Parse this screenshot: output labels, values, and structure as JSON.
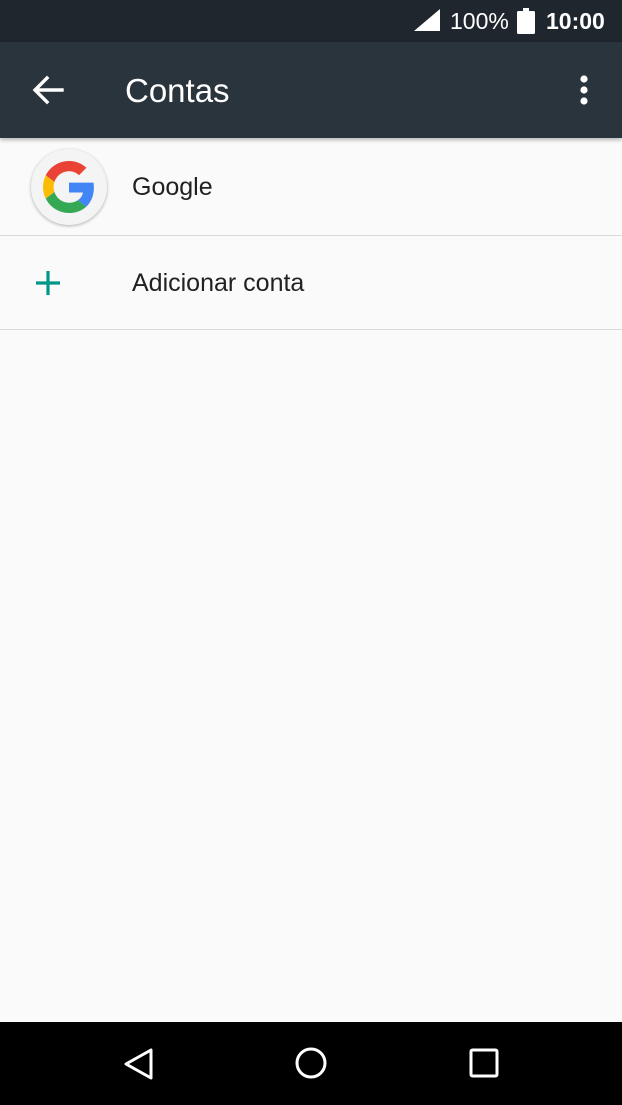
{
  "status_bar": {
    "battery_percent": "100%",
    "time": "10:00",
    "icons": [
      "signal-icon",
      "battery-icon"
    ]
  },
  "app_bar": {
    "title": "Contas",
    "icons": [
      "back-arrow-icon",
      "overflow-menu-icon"
    ]
  },
  "accounts": {
    "items": [
      {
        "label": "Google",
        "icon": "google-icon"
      },
      {
        "label": "Adicionar conta",
        "icon": "plus-icon"
      }
    ]
  },
  "nav_bar": {
    "icons": [
      "back-triangle-icon",
      "home-circle-icon",
      "recents-square-icon"
    ]
  },
  "colors": {
    "status_bar": "#1f262d",
    "app_bar": "#2a343d",
    "background": "#fafafa",
    "accent": "#009688",
    "divider": "#dadada",
    "text_primary": "#212121",
    "nav_bar": "#000000"
  }
}
